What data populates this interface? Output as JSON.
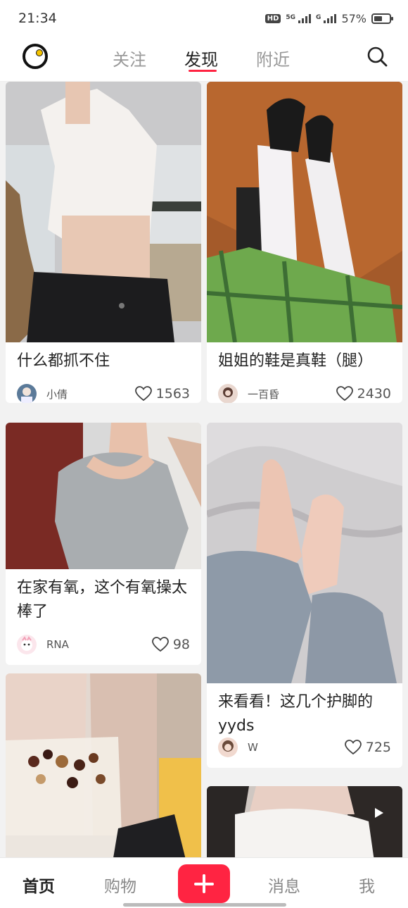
{
  "status_bar": {
    "time": "21:34",
    "hd_badge": "HD",
    "network_1": "5G",
    "network_2": "G",
    "battery_percent": "57%",
    "battery_level": 0.57
  },
  "top_nav": {
    "tabs": [
      {
        "label": "关注",
        "active": false
      },
      {
        "label": "发现",
        "active": true
      },
      {
        "label": "附近",
        "active": false
      }
    ],
    "accent_color": "#ff2442"
  },
  "feed": {
    "cards": [
      {
        "title": "什么都抓不住",
        "author": "小倩",
        "likes": "1563"
      },
      {
        "title": "姐姐的鞋是真鞋（腿）",
        "author": "一百昏",
        "likes": "2430"
      },
      {
        "title": "在家有氧，这个有氧操太棒了",
        "author": "RNA",
        "likes": "98"
      },
      {
        "title": "来看看！这几个护脚的yyds",
        "author": "W",
        "likes": "725"
      },
      {
        "title": "",
        "author": "",
        "likes": ""
      },
      {
        "title": "",
        "author": "",
        "likes": "",
        "has_video": true
      }
    ]
  },
  "bottom_nav": {
    "home": "首页",
    "shop": "购物",
    "add_icon": "plus-icon",
    "messages": "消息",
    "me": "我",
    "add_button_color": "#ff2442"
  }
}
